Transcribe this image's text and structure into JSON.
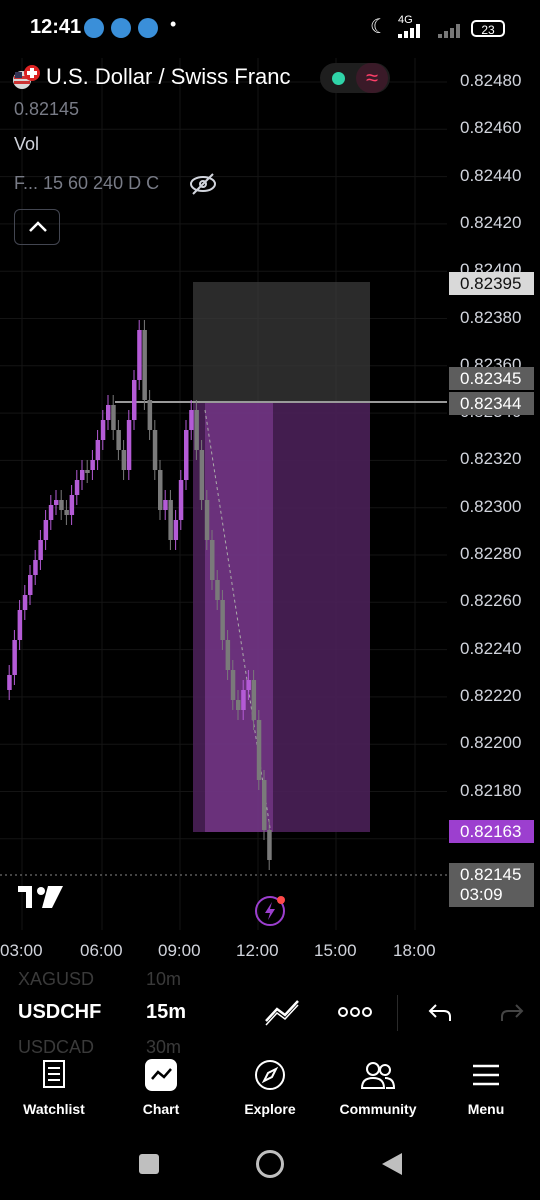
{
  "status_bar": {
    "time": "12:41",
    "network": "4G",
    "battery": "23"
  },
  "header": {
    "title": "U.S. Dollar / Swiss Franc",
    "last_price": "0.82145",
    "volume_label": "Vol",
    "intervals": "F... 15 60 240 D C"
  },
  "price_axis": {
    "labels": [
      "0.82480",
      "0.82460",
      "0.82440",
      "0.82420",
      "0.82400",
      "0.82380",
      "0.82360",
      "0.82340",
      "0.82320",
      "0.82300",
      "0.82280",
      "0.82260",
      "0.82240",
      "0.82220",
      "0.82200",
      "0.82180",
      "0.82160"
    ],
    "tags": [
      {
        "text": "0.82395",
        "style": "light"
      },
      {
        "text": "0.82345",
        "style": "dark"
      },
      {
        "text": "0.82344",
        "style": "dark"
      },
      {
        "text": "0.82163",
        "style": "purple"
      },
      {
        "text": "0.82145",
        "style": "dark"
      }
    ],
    "countdown": "03:09"
  },
  "time_axis": {
    "labels": [
      "03:00",
      "06:00",
      "09:00",
      "12:00",
      "15:00",
      "18:00"
    ]
  },
  "toolbar": {
    "symbol_prev": "XAGUSD",
    "symbol": "USDCHF",
    "symbol_next": "USDCAD",
    "interval_prev": "10m",
    "interval": "15m",
    "interval_next": "30m"
  },
  "tabs": [
    {
      "label": "Watchlist",
      "icon": "watchlist-icon"
    },
    {
      "label": "Chart",
      "icon": "chart-icon"
    },
    {
      "label": "Explore",
      "icon": "compass-icon"
    },
    {
      "label": "Community",
      "icon": "community-icon"
    },
    {
      "label": "Menu",
      "icon": "menu-icon"
    }
  ],
  "colors": {
    "up": "#b45bd6",
    "down": "#7a7a7a",
    "accent": "#9c3fcf",
    "bg": "#000000"
  }
}
